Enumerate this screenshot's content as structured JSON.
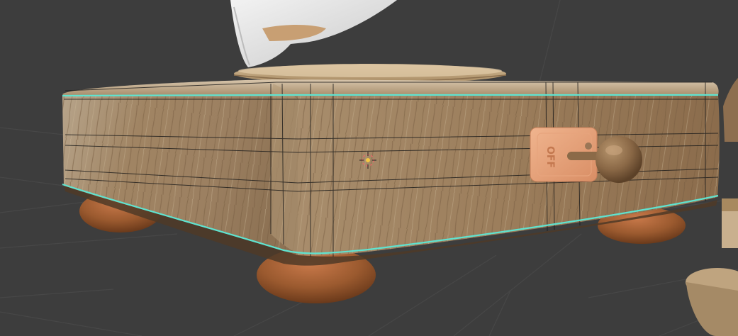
{
  "viewport": {
    "background": "#3d3d3d",
    "grid_color": "#4a4a4a",
    "selected_edge_color": "#5fe3d0",
    "wireframe_color": "#1a1a1a",
    "origin_marker": "3d-cursor-icon"
  },
  "scene": {
    "objects": [
      {
        "name": "wooden-box",
        "material": "wood",
        "selected": true
      },
      {
        "name": "toggle-switch",
        "label": "OFF"
      },
      {
        "name": "switch-lever-knob"
      },
      {
        "name": "box-feet",
        "count": 3
      },
      {
        "name": "turntable-platter"
      },
      {
        "name": "white-cloth-figure"
      },
      {
        "name": "side-wooden-object"
      }
    ]
  },
  "switch_plate": {
    "text": "OFF"
  }
}
